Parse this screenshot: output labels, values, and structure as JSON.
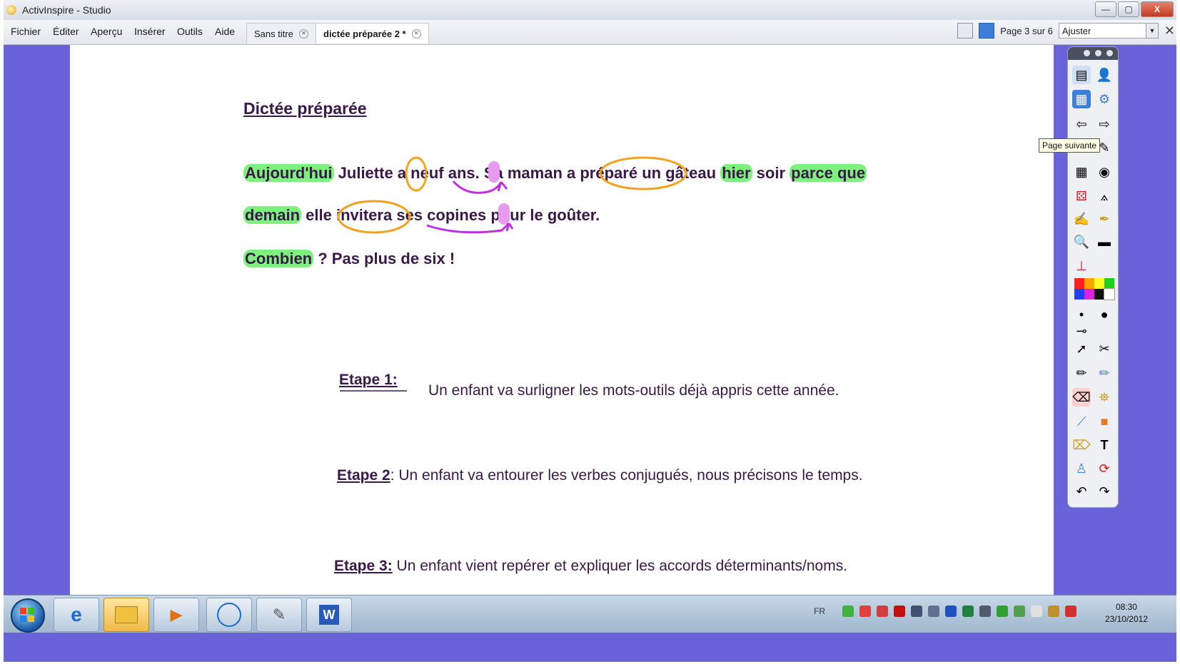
{
  "window": {
    "title": "ActivInspire - Studio",
    "controls": [
      "—",
      "▢",
      "X"
    ]
  },
  "menu": [
    "Fichier",
    "Éditer",
    "Aperçu",
    "Insérer",
    "Outils",
    "Aide"
  ],
  "tabs": [
    {
      "label": "Sans titre",
      "active": false
    },
    {
      "label": "dictée préparée 2 *",
      "active": true
    }
  ],
  "page_indicator": "Page 3 sur 6",
  "zoom": "Ajuster",
  "document": {
    "title": "Dictée préparée",
    "line1": {
      "w1": "Aujourd'hui",
      "w2": " Juliette ",
      "w3": "a",
      "w4": " neuf ans.  Sa maman ",
      "w5": "a préparé",
      "w6": " un gâteau ",
      "w7": "hier",
      "w8": " soir ",
      "w9": "parce que"
    },
    "line2": {
      "w1": "demain",
      "w2": " elle ",
      "w3": "invitera",
      "w4": " ses copines pour le goûter."
    },
    "line3": {
      "w1": "Combien",
      "w2": " ?  Pas plus de six !"
    },
    "steps": [
      {
        "label": "Etape 1:",
        "text": "Un enfant va surligner les mots-outils déjà appris cette année."
      },
      {
        "label": "Etape 2",
        "text": ": Un enfant va entourer les verbes conjugués, nous précisons le temps."
      },
      {
        "label": "Etape 3:",
        "text": " Un enfant vient repérer et expliquer les accords déterminants/noms."
      }
    ]
  },
  "tooltip": "Page suivante",
  "palette_colors": [
    "#ff2020",
    "#ffa500",
    "#ffff20",
    "#20d020",
    "#2040ff",
    "#e020e0",
    "#101010",
    "#ffffff"
  ],
  "colors": {
    "highlight": "#7ef07e",
    "circle": "#f2a21e",
    "arrow": "#c030e0",
    "frame": "#6a62d8"
  },
  "taskbar": {
    "language": "FR",
    "clock_time": "08:30",
    "clock_date": "23/10/2012",
    "apps": [
      "ie-icon",
      "explorer-icon",
      "media-player-icon",
      "dell-icon",
      "activinspire-icon",
      "word-icon"
    ]
  }
}
